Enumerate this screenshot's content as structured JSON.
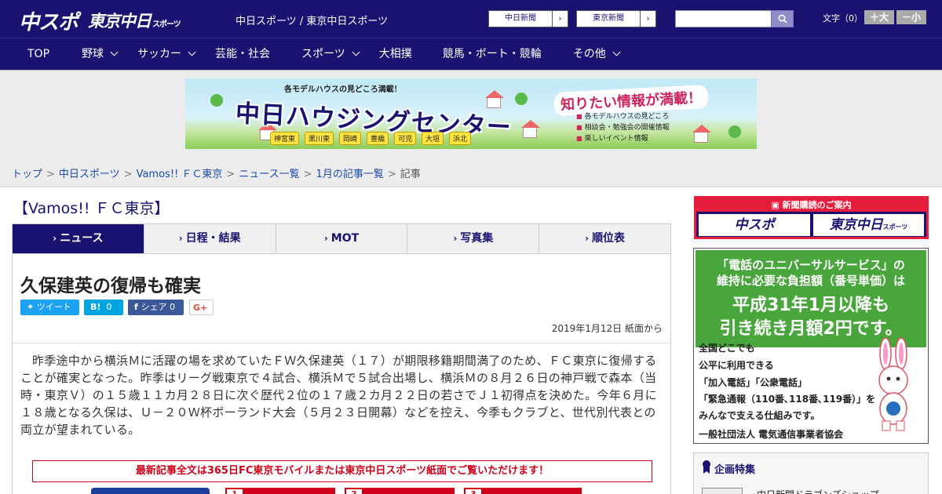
{
  "header": {
    "logo_chuspo": "中スポ",
    "logo_tokyo": "東京中日",
    "logo_tokyo_sub": "スポーツ",
    "site_title": "中日スポーツ / 東京中日スポーツ",
    "btn_chunichi": "中日新聞",
    "btn_tokyo": "東京新聞",
    "btn_arrow": "›",
    "font_size_label": "文字（0）",
    "font_plus": "＋大",
    "font_minus": "－小"
  },
  "nav": [
    {
      "label": "TOP",
      "chevron": false
    },
    {
      "label": "野球",
      "chevron": true
    },
    {
      "label": "サッカー",
      "chevron": true
    },
    {
      "label": "芸能・社会",
      "chevron": false
    },
    {
      "label": "スポーツ",
      "chevron": true
    },
    {
      "label": "大相撲",
      "chevron": false
    },
    {
      "label": "競馬・ボート・競輪",
      "chevron": false
    },
    {
      "label": "その他",
      "chevron": true
    }
  ],
  "banner": {
    "top": "各モデルハウスの見どころ満載！",
    "main": "中日ハウジングセンター",
    "right": "知りたい情報が満載！",
    "list": [
      "各モデルハウスの見どころ",
      "相談会・勉強会の開催情報",
      "楽しいイベント情報"
    ],
    "cities": [
      "神宮東",
      "黒川東",
      "岡崎",
      "豊橋",
      "可児",
      "大垣",
      "浜北"
    ]
  },
  "breadcrumb": {
    "items": [
      "トップ",
      "中日スポーツ",
      "Vamos!! ＦＣ東京",
      "ニュース一覧",
      "1月の記事一覧"
    ],
    "current": "記事",
    "sep": ">"
  },
  "section_title": "【Vamos!! ＦＣ東京】",
  "tabs": [
    "ニュース",
    "日程・結果",
    "MOT",
    "写真集",
    "順位表"
  ],
  "article": {
    "headline": "久保建英の復帰も確実",
    "share_tweet": "ツイート",
    "share_hatena": "B!",
    "share_hatena_count": "0",
    "share_fb": "シェア",
    "share_fb_count": "0",
    "share_gplus": "G+",
    "date": "2019年1月12日 紙面から",
    "body": "昨季途中から横浜Ｍに活躍の場を求めていたＦＷ久保建英（１７）が期限移籍期間満了のため、ＦＣ東京に復帰することが確実となった。昨季はリーグ戦東京で４試合、横浜Ｍで５試合出場し、横浜Ｍの８月２６日の神戸戦で森本（当時・東京Ｖ）の１５歳１１カ月２８日に次ぐ歴代２位の１７歳２カ月２２日の若さでＪ１初得点を決めた。今年６月に１８歳となる久保は、Ｕ－２０Ｗ杯ポーランド大会（５月２３日開幕）などを控え、今季もクラブと、世代別代表との両立が望まれている。",
    "notice": "最新記事全文は365日FC東京モバイルまたは東京中日スポーツ紙面でご覧いただけます！",
    "ranks": [
      "1",
      "2",
      "3"
    ]
  },
  "sidebar": {
    "sub_head": "新聞購読のご案内",
    "sub_logo1": "中スポ",
    "sub_logo2": "東京中日",
    "ad_line1": "「電話のユニバーサルサービス」の",
    "ad_line2": "維持に必要な負担額（番号単価）は",
    "ad_line3": "平成31年1月以降も",
    "ad_line4": "引き続き月額2円です。",
    "ad_t1": "全国どこでも",
    "ad_t2": "公平に利用できる",
    "ad_t3": "「加入電話」「公衆電話」",
    "ad_t4": "「緊急通報（110番､118番､119番）」を",
    "ad_t5": "みんなで支える仕組みです。",
    "ad_foot": "一般社団法人 電気通信事業者協会",
    "feature_title": "企画特集",
    "feature_item": "中日新聞ドラゴンズショップ"
  },
  "colors": {
    "brand": "#1a1270",
    "accent": "#d0021b",
    "twitter": "#1da1f2",
    "hatena": "#00a4de",
    "facebook": "#3b5998"
  }
}
